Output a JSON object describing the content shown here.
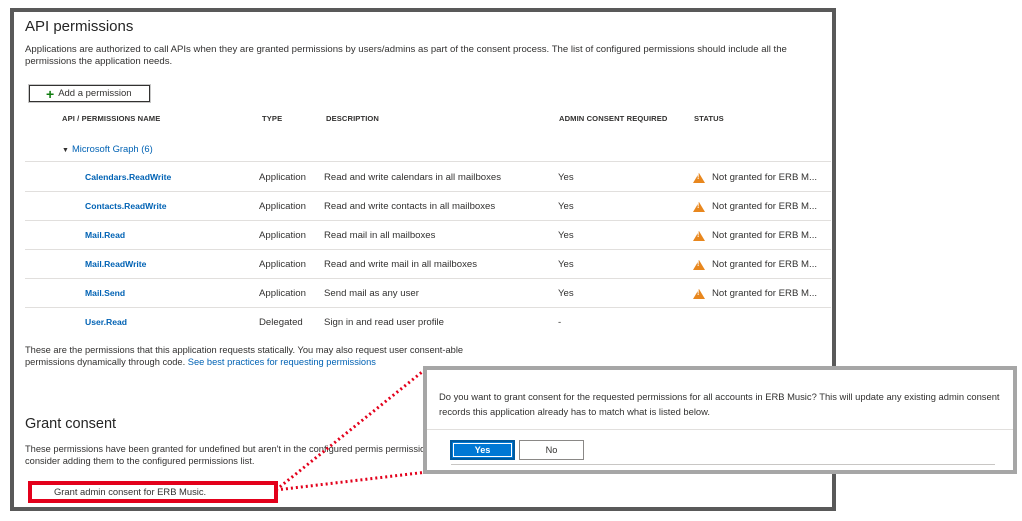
{
  "page": {
    "title": "API permissions",
    "intro": "Applications are authorized to call APIs when they are granted permissions by users/admins as part of the consent process. The list of configured permissions should include all the permissions the application needs.",
    "add_permission_label": "Add a permission"
  },
  "table": {
    "headers": {
      "name": "API / PERMISSIONS NAME",
      "type": "TYPE",
      "description": "DESCRIPTION",
      "admin": "ADMIN CONSENT REQUIRED",
      "status": "STATUS"
    },
    "group": "Microsoft Graph (6)",
    "rows": [
      {
        "name": "Calendars.ReadWrite",
        "type": "Application",
        "description": "Read and write calendars in all mailboxes",
        "admin": "Yes",
        "status": "Not granted for ERB M..."
      },
      {
        "name": "Contacts.ReadWrite",
        "type": "Application",
        "description": "Read and write contacts in all mailboxes",
        "admin": "Yes",
        "status": "Not granted for ERB M..."
      },
      {
        "name": "Mail.Read",
        "type": "Application",
        "description": "Read mail in all mailboxes",
        "admin": "Yes",
        "status": "Not granted for ERB M..."
      },
      {
        "name": "Mail.ReadWrite",
        "type": "Application",
        "description": "Read and write mail in all mailboxes",
        "admin": "Yes",
        "status": "Not granted for ERB M..."
      },
      {
        "name": "Mail.Send",
        "type": "Application",
        "description": "Send mail as any user",
        "admin": "Yes",
        "status": "Not granted for ERB M..."
      },
      {
        "name": "User.Read",
        "type": "Delegated",
        "description": "Sign in and read user profile",
        "admin": "-",
        "status": ""
      }
    ]
  },
  "static_note": {
    "text": "These are the permissions that this application requests statically. You may also request user consent-able permissions dynamically through code.",
    "link": "See best practices for requesting permissions"
  },
  "grant": {
    "title": "Grant consent",
    "description": "These permissions have been granted for undefined but aren't in the configured permis permissions, you should consider adding them to the configured permissions list.",
    "button_label": "Grant admin consent for ERB Music."
  },
  "dialog": {
    "message": "Do you want to grant consent for the requested permissions for all accounts in ERB Music? This will update any existing admin consent records this application already has to match what is listed below.",
    "yes_label": "Yes",
    "no_label": "No"
  },
  "colors": {
    "link": "#0062b4",
    "primary": "#0078d4",
    "warning": "#e8871e",
    "highlight": "#e3001b"
  },
  "icons": {
    "add": "plus-icon",
    "expand": "caret-down-icon",
    "warning": "warning-icon"
  }
}
